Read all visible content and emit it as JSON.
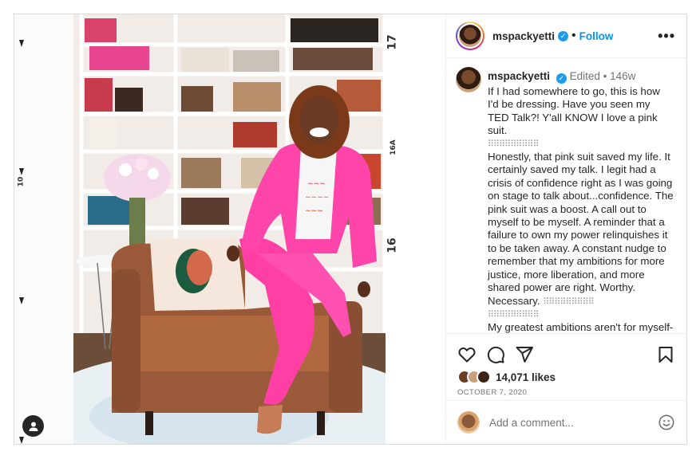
{
  "account": {
    "username": "mspackyetti",
    "verified_icon": "verified-badge-icon",
    "separator": "•",
    "follow_label": "Follow",
    "more_label": "•••"
  },
  "caption": {
    "username": "mspackyetti",
    "edited": "Edited",
    "separator": "•",
    "age": "146w",
    "p1": "If I had somewhere to go, this is how I'd be dressing. Have you seen my TED Talk?! Y'all KNOW I love a pink suit.",
    "dots1": "⠿⠿⠿⠿⠿⠿⠿⠿⠿",
    "p2": "Honestly, that pink suit saved my life. It certainly saved my talk. I legit had a crisis of confidence right as I was going on stage to talk about...confidence. The pink suit was a boost. A call out to myself to be myself. A reminder that a failure to own my power relinquishes it to be taken away. A constant nudge to remember that my ambitions for more justice, more liberation, and more shared power are right. Worthy. Necessary.",
    "dots2": "⠿⠿⠿⠿⠿⠿⠿⠿⠿",
    "dots3": "⠿⠿⠿⠿⠿⠿⠿⠿⠿",
    "p3": "My greatest ambitions aren't for myself- they're for all of us to thrive. It's why the"
  },
  "media": {
    "ruler_top": "17",
    "ruler_mid": "16A",
    "ruler_low": "16",
    "ruler_left": "10",
    "photo_alt": "Woman in pink suit sitting on a leather armchair in front of bookshelves",
    "tag_icon": "user-tag-icon"
  },
  "actions": {
    "like_icon": "heart-icon",
    "comment_icon": "comment-icon",
    "share_icon": "share-icon",
    "save_icon": "bookmark-icon"
  },
  "likes": {
    "count_text": "14,071 likes"
  },
  "date": "OCTOBER 7, 2020",
  "comment": {
    "placeholder": "Add a comment...",
    "emoji_icon": "emoji-icon"
  },
  "colors": {
    "accent": "#0095f6",
    "verified": "#1d9bf0",
    "suit_pink": "#ff3fa4"
  }
}
